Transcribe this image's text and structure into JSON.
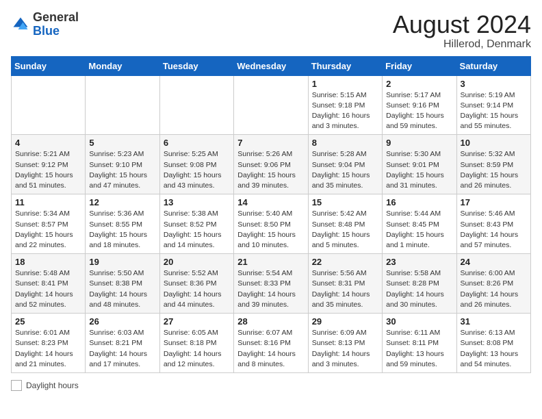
{
  "logo": {
    "general": "General",
    "blue": "Blue"
  },
  "title": {
    "month_year": "August 2024",
    "location": "Hillerod, Denmark"
  },
  "days_of_week": [
    "Sunday",
    "Monday",
    "Tuesday",
    "Wednesday",
    "Thursday",
    "Friday",
    "Saturday"
  ],
  "footer": {
    "label": "Daylight hours"
  },
  "weeks": [
    {
      "days": [
        {
          "num": "",
          "info": ""
        },
        {
          "num": "",
          "info": ""
        },
        {
          "num": "",
          "info": ""
        },
        {
          "num": "",
          "info": ""
        },
        {
          "num": "1",
          "info": "Sunrise: 5:15 AM\nSunset: 9:18 PM\nDaylight: 16 hours\nand 3 minutes."
        },
        {
          "num": "2",
          "info": "Sunrise: 5:17 AM\nSunset: 9:16 PM\nDaylight: 15 hours\nand 59 minutes."
        },
        {
          "num": "3",
          "info": "Sunrise: 5:19 AM\nSunset: 9:14 PM\nDaylight: 15 hours\nand 55 minutes."
        }
      ]
    },
    {
      "days": [
        {
          "num": "4",
          "info": "Sunrise: 5:21 AM\nSunset: 9:12 PM\nDaylight: 15 hours\nand 51 minutes."
        },
        {
          "num": "5",
          "info": "Sunrise: 5:23 AM\nSunset: 9:10 PM\nDaylight: 15 hours\nand 47 minutes."
        },
        {
          "num": "6",
          "info": "Sunrise: 5:25 AM\nSunset: 9:08 PM\nDaylight: 15 hours\nand 43 minutes."
        },
        {
          "num": "7",
          "info": "Sunrise: 5:26 AM\nSunset: 9:06 PM\nDaylight: 15 hours\nand 39 minutes."
        },
        {
          "num": "8",
          "info": "Sunrise: 5:28 AM\nSunset: 9:04 PM\nDaylight: 15 hours\nand 35 minutes."
        },
        {
          "num": "9",
          "info": "Sunrise: 5:30 AM\nSunset: 9:01 PM\nDaylight: 15 hours\nand 31 minutes."
        },
        {
          "num": "10",
          "info": "Sunrise: 5:32 AM\nSunset: 8:59 PM\nDaylight: 15 hours\nand 26 minutes."
        }
      ]
    },
    {
      "days": [
        {
          "num": "11",
          "info": "Sunrise: 5:34 AM\nSunset: 8:57 PM\nDaylight: 15 hours\nand 22 minutes."
        },
        {
          "num": "12",
          "info": "Sunrise: 5:36 AM\nSunset: 8:55 PM\nDaylight: 15 hours\nand 18 minutes."
        },
        {
          "num": "13",
          "info": "Sunrise: 5:38 AM\nSunset: 8:52 PM\nDaylight: 15 hours\nand 14 minutes."
        },
        {
          "num": "14",
          "info": "Sunrise: 5:40 AM\nSunset: 8:50 PM\nDaylight: 15 hours\nand 10 minutes."
        },
        {
          "num": "15",
          "info": "Sunrise: 5:42 AM\nSunset: 8:48 PM\nDaylight: 15 hours\nand 5 minutes."
        },
        {
          "num": "16",
          "info": "Sunrise: 5:44 AM\nSunset: 8:45 PM\nDaylight: 15 hours\nand 1 minute."
        },
        {
          "num": "17",
          "info": "Sunrise: 5:46 AM\nSunset: 8:43 PM\nDaylight: 14 hours\nand 57 minutes."
        }
      ]
    },
    {
      "days": [
        {
          "num": "18",
          "info": "Sunrise: 5:48 AM\nSunset: 8:41 PM\nDaylight: 14 hours\nand 52 minutes."
        },
        {
          "num": "19",
          "info": "Sunrise: 5:50 AM\nSunset: 8:38 PM\nDaylight: 14 hours\nand 48 minutes."
        },
        {
          "num": "20",
          "info": "Sunrise: 5:52 AM\nSunset: 8:36 PM\nDaylight: 14 hours\nand 44 minutes."
        },
        {
          "num": "21",
          "info": "Sunrise: 5:54 AM\nSunset: 8:33 PM\nDaylight: 14 hours\nand 39 minutes."
        },
        {
          "num": "22",
          "info": "Sunrise: 5:56 AM\nSunset: 8:31 PM\nDaylight: 14 hours\nand 35 minutes."
        },
        {
          "num": "23",
          "info": "Sunrise: 5:58 AM\nSunset: 8:28 PM\nDaylight: 14 hours\nand 30 minutes."
        },
        {
          "num": "24",
          "info": "Sunrise: 6:00 AM\nSunset: 8:26 PM\nDaylight: 14 hours\nand 26 minutes."
        }
      ]
    },
    {
      "days": [
        {
          "num": "25",
          "info": "Sunrise: 6:01 AM\nSunset: 8:23 PM\nDaylight: 14 hours\nand 21 minutes."
        },
        {
          "num": "26",
          "info": "Sunrise: 6:03 AM\nSunset: 8:21 PM\nDaylight: 14 hours\nand 17 minutes."
        },
        {
          "num": "27",
          "info": "Sunrise: 6:05 AM\nSunset: 8:18 PM\nDaylight: 14 hours\nand 12 minutes."
        },
        {
          "num": "28",
          "info": "Sunrise: 6:07 AM\nSunset: 8:16 PM\nDaylight: 14 hours\nand 8 minutes."
        },
        {
          "num": "29",
          "info": "Sunrise: 6:09 AM\nSunset: 8:13 PM\nDaylight: 14 hours\nand 3 minutes."
        },
        {
          "num": "30",
          "info": "Sunrise: 6:11 AM\nSunset: 8:11 PM\nDaylight: 13 hours\nand 59 minutes."
        },
        {
          "num": "31",
          "info": "Sunrise: 6:13 AM\nSunset: 8:08 PM\nDaylight: 13 hours\nand 54 minutes."
        }
      ]
    }
  ]
}
